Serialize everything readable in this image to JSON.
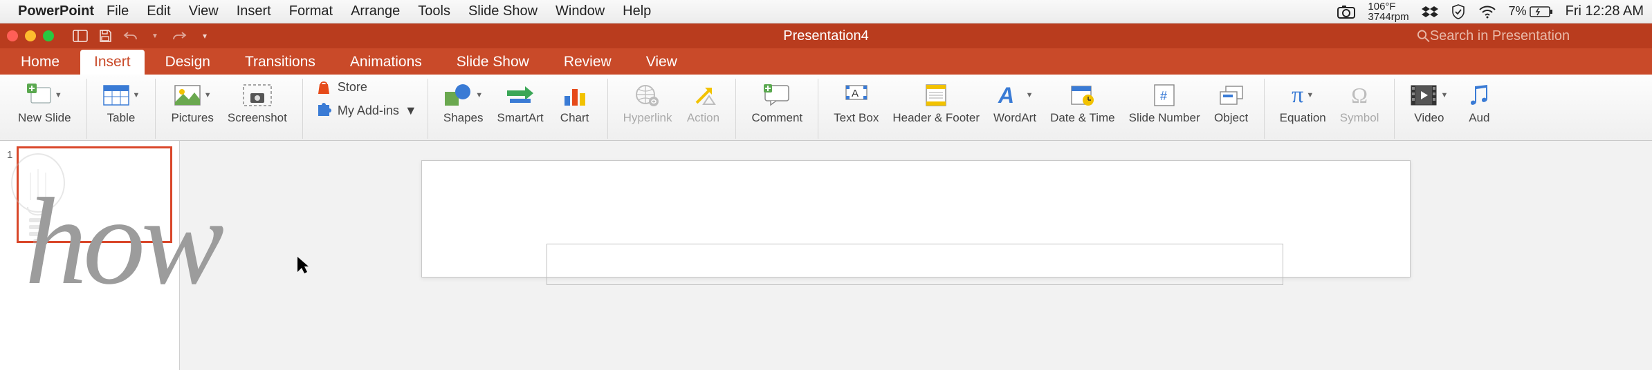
{
  "mac_menu": {
    "app": "PowerPoint",
    "items": [
      "File",
      "Edit",
      "View",
      "Insert",
      "Format",
      "Arrange",
      "Tools",
      "Slide Show",
      "Window",
      "Help"
    ],
    "temp_line1": "106°F",
    "temp_line2": "3744rpm",
    "battery": "7%",
    "clock": "Fri 12:28 AM"
  },
  "titlebar": {
    "title": "Presentation4",
    "search_placeholder": "Search in Presentation"
  },
  "tabs": {
    "items": [
      "Home",
      "Insert",
      "Design",
      "Transitions",
      "Animations",
      "Slide Show",
      "Review",
      "View"
    ],
    "active": "Insert"
  },
  "ribbon": {
    "new_slide": "New Slide",
    "table": "Table",
    "pictures": "Pictures",
    "screenshot": "Screenshot",
    "store": "Store",
    "addins": "My Add-ins",
    "shapes": "Shapes",
    "smartart": "SmartArt",
    "chart": "Chart",
    "hyperlink": "Hyperlink",
    "action": "Action",
    "comment": "Comment",
    "textbox": "Text Box",
    "header_footer": "Header & Footer",
    "wordart": "WordArt",
    "datetime": "Date & Time",
    "slidenum": "Slide Number",
    "object": "Object",
    "equation": "Equation",
    "symbol": "Symbol",
    "video": "Video",
    "audio": "Aud"
  },
  "thumbnail": {
    "number": "1"
  },
  "watermark": "how"
}
